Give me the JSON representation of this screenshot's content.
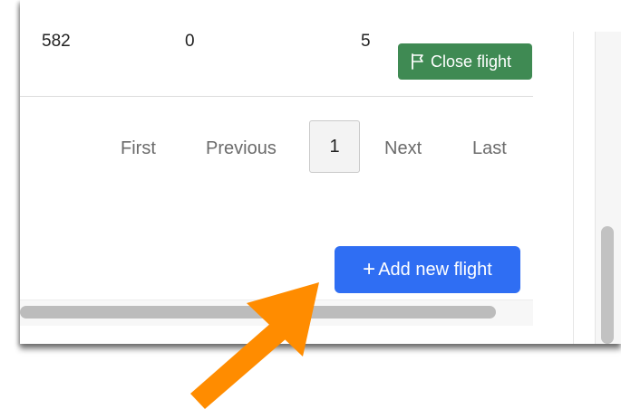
{
  "table_row": {
    "col1": "582",
    "col2": "0",
    "col3": "5",
    "close_label": "Close flight"
  },
  "pagination": {
    "first": "First",
    "previous": "Previous",
    "current": "1",
    "next": "Next",
    "last": "Last"
  },
  "actions": {
    "add_label": "Add new flight",
    "add_symbol": "+"
  },
  "colors": {
    "close_button": "#3f8a53",
    "add_button": "#2f6ef3",
    "annotation_arrow": "#ff8c00"
  },
  "icons": {
    "close": "flag-icon",
    "add": "plus-icon",
    "annotation": "arrow-icon"
  }
}
